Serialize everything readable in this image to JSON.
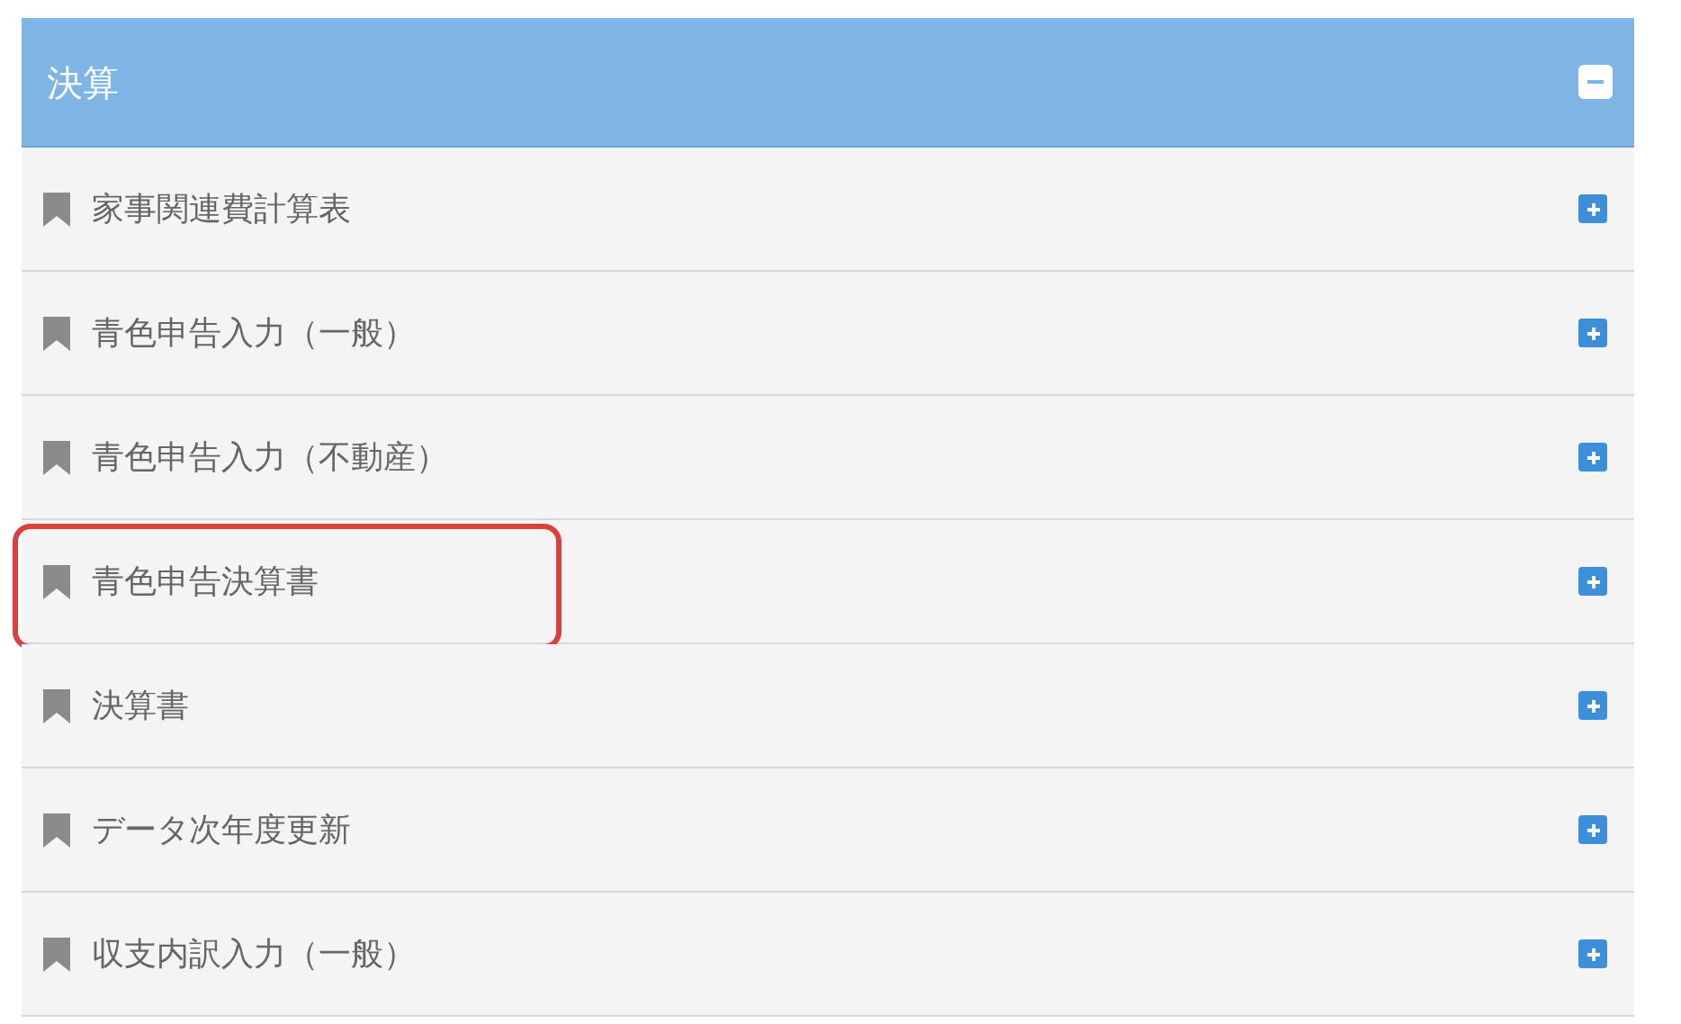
{
  "panel": {
    "title": "決算",
    "expanded": true,
    "items": [
      {
        "label": "家事関連費計算表",
        "expanded": false,
        "highlighted": false
      },
      {
        "label": "青色申告入力（一般）",
        "expanded": false,
        "highlighted": false
      },
      {
        "label": "青色申告入力（不動産）",
        "expanded": false,
        "highlighted": false
      },
      {
        "label": "青色申告決算書",
        "expanded": false,
        "highlighted": true
      },
      {
        "label": "決算書",
        "expanded": false,
        "highlighted": false
      },
      {
        "label": "データ次年度更新",
        "expanded": false,
        "highlighted": false
      },
      {
        "label": "収支内訳入力（一般）",
        "expanded": false,
        "highlighted": false
      }
    ]
  }
}
